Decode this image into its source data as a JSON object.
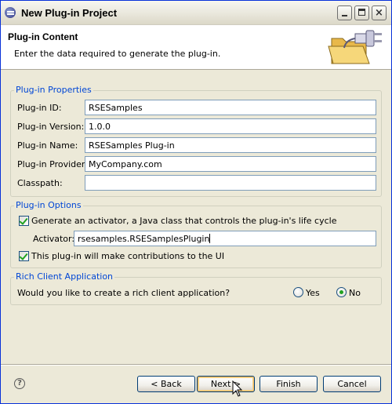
{
  "window": {
    "title": "New Plug-in Project",
    "controls": {
      "minimize": "minimize",
      "maximize": "maximize",
      "close": "×"
    }
  },
  "header": {
    "title": "Plug-in Content",
    "description": "Enter the data required to generate the plug-in.",
    "banner_icon": "open-folder-plug-icon"
  },
  "properties": {
    "legend": "Plug-in Properties",
    "fields": [
      {
        "label": "Plug-in ID:",
        "value": "RSESamples"
      },
      {
        "label": "Plug-in Version:",
        "value": "1.0.0"
      },
      {
        "label": "Plug-in Name:",
        "value": "RSESamples Plug-in"
      },
      {
        "label": "Plug-in Provider:",
        "value": "MyCompany.com"
      },
      {
        "label": "Classpath:",
        "value": ""
      }
    ]
  },
  "options": {
    "legend": "Plug-in Options",
    "generate_activator": {
      "label": "Generate an activator, a Java class that controls the plug-in's life cycle",
      "checked": true
    },
    "activator": {
      "label": "Activator:",
      "value": "rsesamples.RSESamplesPlugin"
    },
    "ui_contributions": {
      "label": "This plug-in will make contributions to the UI",
      "checked": true
    }
  },
  "rcp": {
    "legend": "Rich Client Application",
    "question": "Would you like to create a rich client application?",
    "yes_label": "Yes",
    "no_label": "No",
    "selected": "No"
  },
  "buttons": {
    "help": "?",
    "back": "< Back",
    "next": "Next >",
    "finish": "Finish",
    "cancel": "Cancel"
  },
  "colors": {
    "window_bg": "#ece9d8",
    "group_legend": "#0046d5",
    "input_border": "#7f9db9",
    "check_green": "#21a121"
  }
}
